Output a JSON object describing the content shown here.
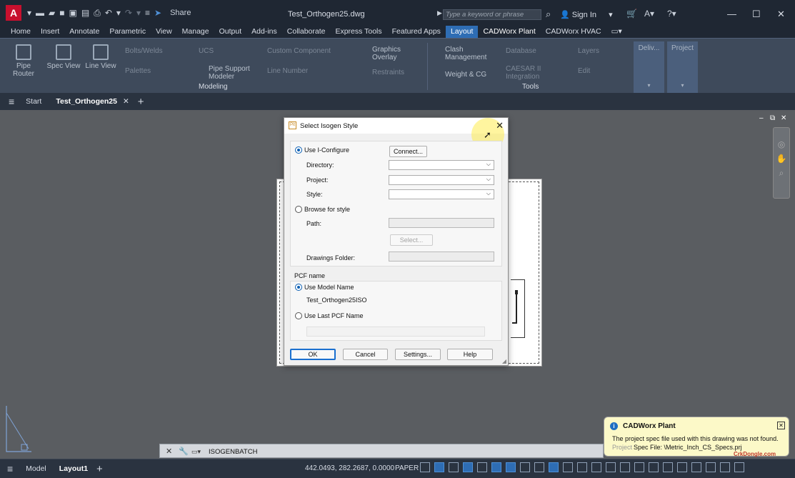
{
  "titlebar": {
    "logo": "A",
    "share": "Share",
    "doc_title": "Test_Orthogen25.dwg",
    "search_placeholder": "Type a keyword or phrase",
    "sign_in": "Sign In"
  },
  "tabs": [
    "Home",
    "Insert",
    "Annotate",
    "Parametric",
    "View",
    "Manage",
    "Output",
    "Add-ins",
    "Collaborate",
    "Express Tools",
    "Featured Apps",
    "Layout",
    "CADWorx Plant",
    "CADWorx HVAC"
  ],
  "active_tab": "Layout",
  "ribbon": {
    "pipe_router": "Pipe Router",
    "spec_view": "Spec View",
    "line_view": "Line View",
    "bolts": "Bolts/Welds",
    "palettes": "Palettes",
    "ucs": "UCS",
    "custom_component": "Custom Component",
    "pipe_support_modeler_1": "Pipe Support",
    "pipe_support_modeler_2": "Modeler",
    "line_number": "Line Number",
    "graphics_overlay_1": "Graphics",
    "graphics_overlay_2": "Overlay",
    "restraints": "Restraints",
    "clash_1": "Clash",
    "clash_2": "Management",
    "weight_cg": "Weight & CG",
    "database": "Database",
    "caesar_1": "CAESAR II",
    "caesar_2": "Integration",
    "layers": "Layers",
    "edit": "Edit",
    "modeling_label": "Modeling",
    "tools_label": "Tools",
    "deliv": "Deliv...",
    "project": "Project"
  },
  "filetabs": {
    "start": "Start",
    "current": "Test_Orthogen25"
  },
  "dialog": {
    "title": "Select Isogen Style",
    "use_iconfigure": "Use I-Configure",
    "connect": "Connect...",
    "directory": "Directory:",
    "project": "Project:",
    "style": "Style:",
    "browse": "Browse for style",
    "path": "Path:",
    "select": "Select...",
    "drawings_folder": "Drawings Folder:",
    "pcf_name": "PCF name",
    "use_model_name": "Use Model Name",
    "model_name_value": "Test_Orthogen25ISO",
    "use_last_pcf": "Use Last PCF Name",
    "ok": "OK",
    "cancel": "Cancel",
    "settings": "Settings...",
    "help": "Help"
  },
  "notification": {
    "title": "CADWorx Plant",
    "line1": "The project spec file used with this drawing was not found.",
    "line2_prefix": "Project",
    "line2": "Spec File: \\Metric_Inch_CS_Specs.prj"
  },
  "watermark": "CrkDongle.com",
  "command_line": {
    "text": "ISOGENBATCH"
  },
  "statusbar": {
    "model": "Model",
    "layout1": "Layout1",
    "coords": "442.0493, 282.2687, 0.0000",
    "paper": "PAPER"
  },
  "colors": {
    "accent": "#2e6db4",
    "ribbon_bg": "#3e4a5b",
    "titlebar_bg": "#1f2733",
    "logo_red": "#c8102e"
  }
}
